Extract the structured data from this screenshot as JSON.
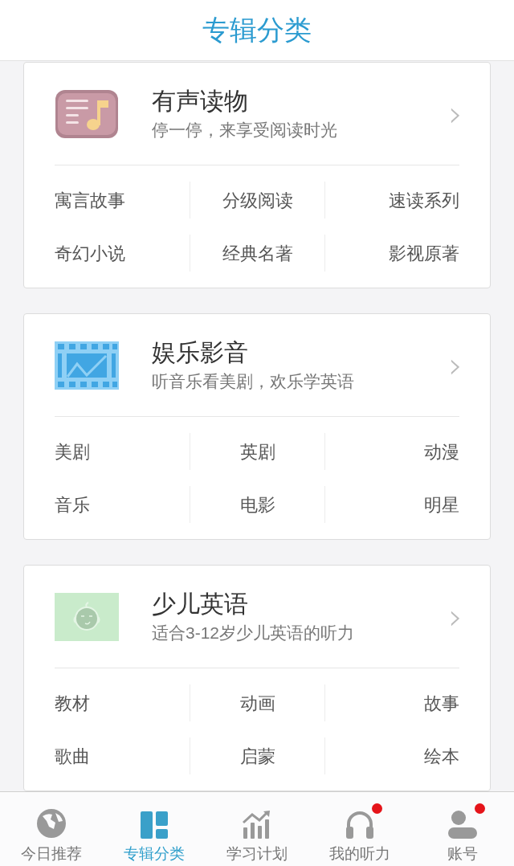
{
  "header": {
    "title": "专辑分类"
  },
  "categories": [
    {
      "kind": "audiobook",
      "title": "有声读物",
      "subtitle": "停一停，来享受阅读时光",
      "chevron": "›",
      "items": [
        "寓言故事",
        "分级阅读",
        "速读系列",
        "奇幻小说",
        "经典名著",
        "影视原著"
      ]
    },
    {
      "kind": "film",
      "title": "娱乐影音",
      "subtitle": "听音乐看美剧，欢乐学英语",
      "chevron": "›",
      "items": [
        "美剧",
        "英剧",
        "动漫",
        "音乐",
        "电影",
        "明星"
      ]
    },
    {
      "kind": "baby",
      "title": "少儿英语",
      "subtitle": "适合3-12岁少儿英语的听力",
      "chevron": "›",
      "items": [
        "教材",
        "动画",
        "故事",
        "歌曲",
        "启蒙",
        "绘本"
      ]
    }
  ],
  "tab_bar": [
    {
      "kind": "globe",
      "label": "今日推荐",
      "selected": false,
      "badge": false
    },
    {
      "kind": "grid",
      "label": "专辑分类",
      "selected": true,
      "badge": false
    },
    {
      "kind": "chart",
      "label": "学习计划",
      "selected": false,
      "badge": false
    },
    {
      "kind": "headphones",
      "label": "我的听力",
      "selected": false,
      "badge": true
    },
    {
      "kind": "person",
      "label": "账号",
      "selected": false,
      "badge": true
    }
  ]
}
